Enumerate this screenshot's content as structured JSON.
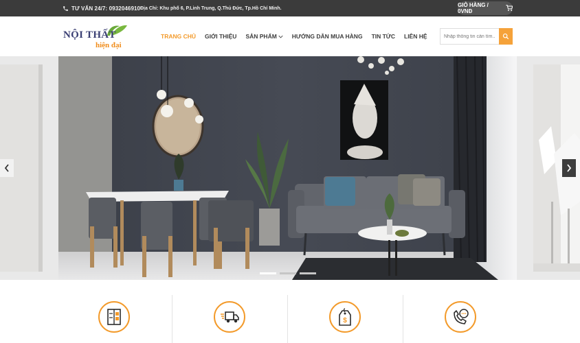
{
  "topbar": {
    "phone": "TƯ VẤN 24/7: 0932046910",
    "address": "Địa Chỉ: Khu phố 6, P.Linh Trung, Q.Thủ Đức, Tp.Hồ Chí Minh.",
    "cart_label": "GIỎ HÀNG / 0VNĐ"
  },
  "logo": {
    "line1": "NỘI THẤT",
    "line2": "hiện đại"
  },
  "nav": {
    "items": [
      {
        "label": "TRANG CHỦ"
      },
      {
        "label": "GIỚI THIỆU"
      },
      {
        "label": "SẢN PHẨM"
      },
      {
        "label": "HƯỚNG DẪN MUA HÀNG"
      },
      {
        "label": "TIN TỨC"
      },
      {
        "label": "LIÊN HỆ"
      }
    ]
  },
  "search": {
    "placeholder": "Nhập thông tin cần tìm..."
  },
  "slider": {
    "total_slides": 3,
    "active_slide": 1
  },
  "features": [
    {
      "icon": "wardrobe-icon"
    },
    {
      "icon": "delivery-truck-icon"
    },
    {
      "icon": "price-tag-icon"
    },
    {
      "icon": "phone-support-icon"
    }
  ],
  "colors": {
    "accent": "#f39a2a",
    "topbar": "#3b3b3b",
    "logo_blue": "#3a3f73",
    "logo_green": "#6aaa3a"
  }
}
